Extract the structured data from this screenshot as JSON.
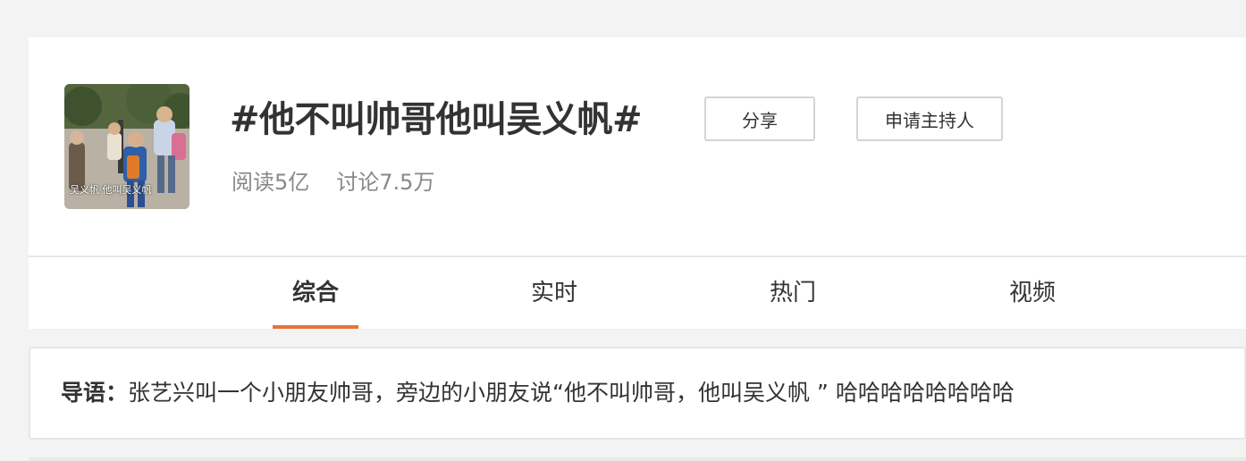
{
  "topic": {
    "title": "#他不叫帅哥他叫吴义帆#",
    "cover_caption": "吴义帆 他叫吴义帆",
    "stats": {
      "reads": "阅读5亿",
      "discussions": "讨论7.5万"
    }
  },
  "buttons": {
    "share": "分享",
    "apply_host": "申请主持人"
  },
  "tabs": [
    {
      "label": "综合",
      "active": true
    },
    {
      "label": "实时",
      "active": false
    },
    {
      "label": "热门",
      "active": false
    },
    {
      "label": "视频",
      "active": false
    }
  ],
  "intro": {
    "label": "导语：",
    "text": "张艺兴叫一个小朋友帅哥，旁边的小朋友说“他不叫帅哥，他叫吴义帆 ” 哈哈哈哈哈哈哈哈"
  },
  "colors": {
    "accent": "#e8723a",
    "page_bg": "#f3f3f3",
    "card_bg": "#ffffff",
    "text_primary": "#333333",
    "text_secondary": "#888888"
  }
}
